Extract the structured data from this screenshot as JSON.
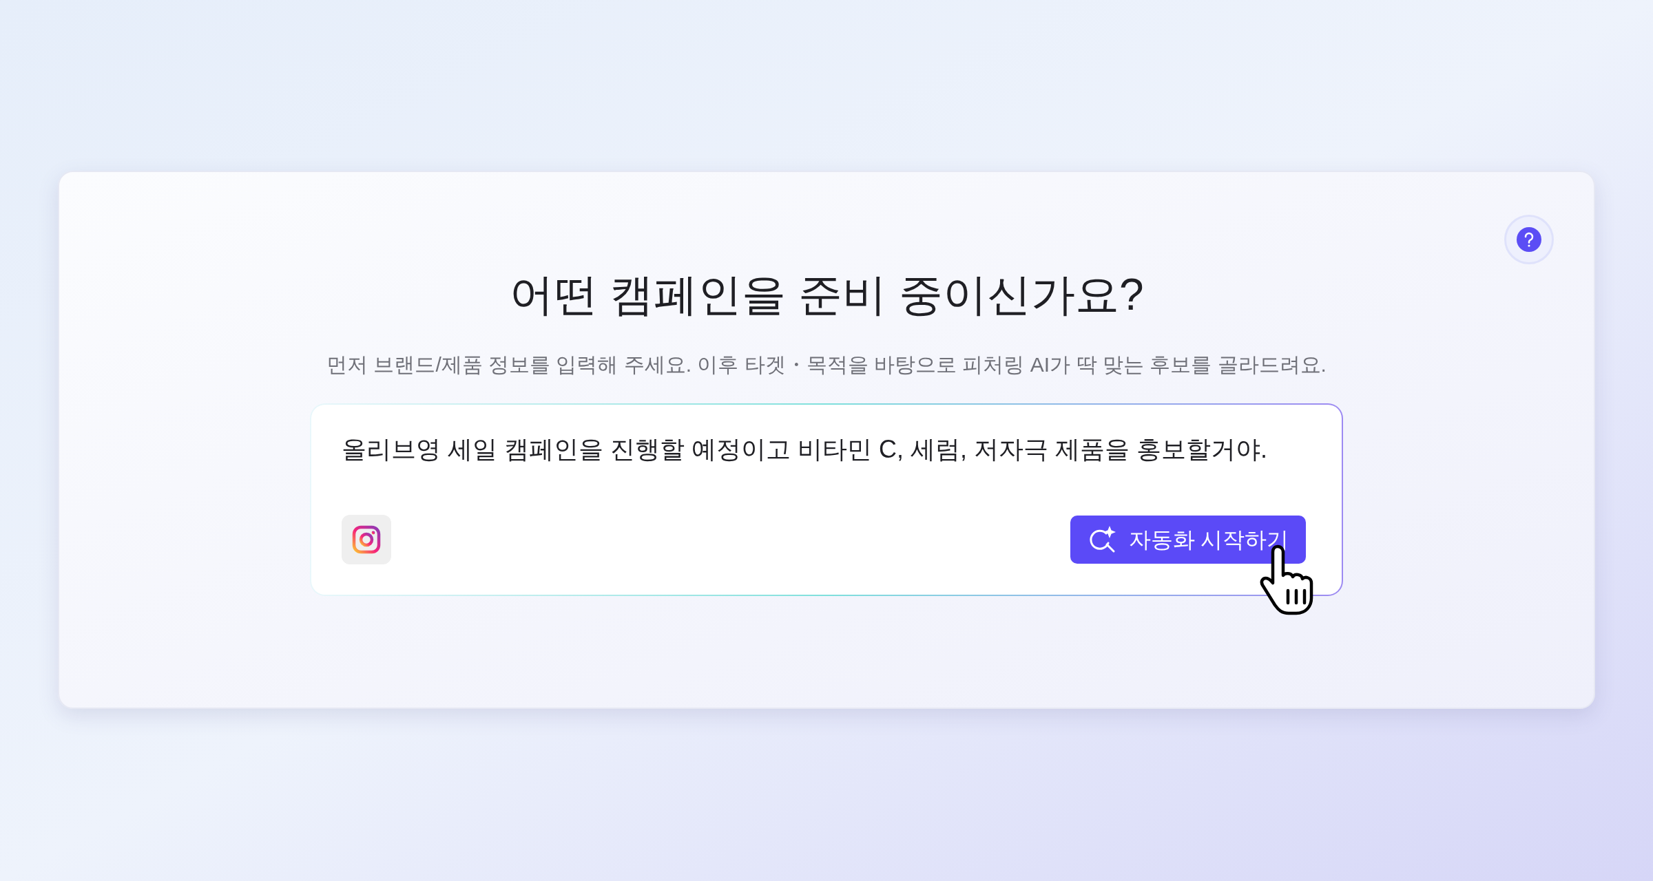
{
  "heading": "어떤 캠페인을 준비 중이신가요?",
  "subtitle": "먼저 브랜드/제품 정보를 입력해 주세요. 이후 타겟・목적을 바탕으로 피처링 AI가 딱 맞는 후보를 골라드려요.",
  "prompt": {
    "value": "올리브영 세일 캠페인을 진행할 예정이고 비타민 C, 세럼, 저자극 제품을 홍보할거야."
  },
  "start_button": {
    "label": "자동화 시작하기"
  }
}
